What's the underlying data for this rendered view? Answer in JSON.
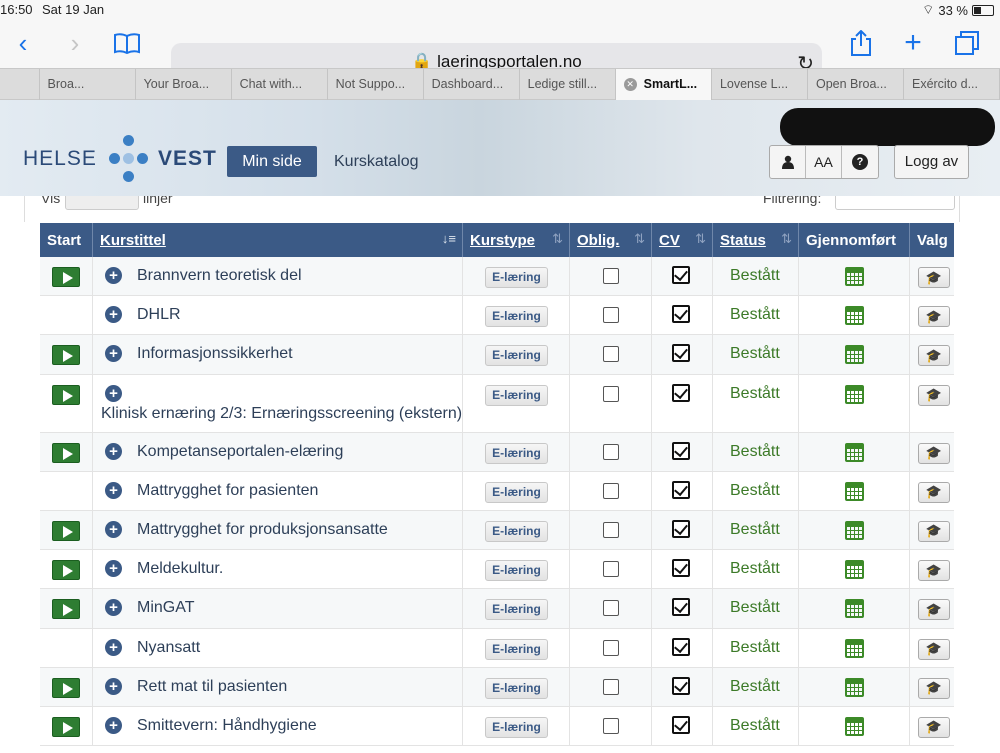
{
  "status_bar": {
    "time": "16:50",
    "date": "Sat 19 Jan",
    "battery": "33 %"
  },
  "browser": {
    "url": "laeringsportalen.no",
    "tabs": [
      "",
      "Broa...",
      "Your Broa...",
      "Chat with...",
      "Not Suppo...",
      "Dashboard...",
      "Ledige still...",
      "SmartL...",
      "Lovense L...",
      "Open Broa...",
      "Exército d..."
    ],
    "active_tab": 7
  },
  "header": {
    "logo_left": "HELSE",
    "logo_right": "VEST",
    "min_side": "Min side",
    "kurskatalog": "Kurskatalog",
    "logg_av": "Logg av",
    "font_btn": "AA"
  },
  "partial": {
    "vis": "Vis",
    "linjer": "linjer",
    "filtrering": "Filtrering:"
  },
  "table": {
    "columns": [
      "Start",
      "Kurstittel",
      "Kurstype",
      "Oblig.",
      "CV",
      "Status",
      "Gjennomført",
      "Valg"
    ],
    "rows": [
      {
        "start": true,
        "title": "Brannvern teoretisk del",
        "type": "E-læring",
        "oblig": false,
        "cv": true,
        "status": "Bestått",
        "wrap": false
      },
      {
        "start": false,
        "title": "DHLR",
        "type": "E-læring",
        "oblig": false,
        "cv": true,
        "status": "Bestått",
        "wrap": false
      },
      {
        "start": true,
        "title": "Informasjonssikkerhet",
        "type": "E-læring",
        "oblig": false,
        "cv": true,
        "status": "Bestått",
        "wrap": false
      },
      {
        "start": true,
        "title": "Klinisk ernæring 2/3: Ernæringsscreening (ekstern)",
        "type": "E-læring",
        "oblig": false,
        "cv": true,
        "status": "Bestått",
        "wrap": true
      },
      {
        "start": true,
        "title": "Kompetanseportalen-elæring",
        "type": "E-læring",
        "oblig": false,
        "cv": true,
        "status": "Bestått",
        "wrap": false
      },
      {
        "start": false,
        "title": "Mattrygghet for pasienten",
        "type": "E-læring",
        "oblig": false,
        "cv": true,
        "status": "Bestått",
        "wrap": false
      },
      {
        "start": true,
        "title": "Mattrygghet for produksjonsansatte",
        "type": "E-læring",
        "oblig": false,
        "cv": true,
        "status": "Bestått",
        "wrap": false
      },
      {
        "start": true,
        "title": "Meldekultur.",
        "type": "E-læring",
        "oblig": false,
        "cv": true,
        "status": "Bestått",
        "wrap": false
      },
      {
        "start": true,
        "title": "MinGAT",
        "type": "E-læring",
        "oblig": false,
        "cv": true,
        "status": "Bestått",
        "wrap": false
      },
      {
        "start": false,
        "title": "Nyansatt",
        "type": "E-læring",
        "oblig": false,
        "cv": true,
        "status": "Bestått",
        "wrap": false
      },
      {
        "start": true,
        "title": "Rett mat til pasienten",
        "type": "E-læring",
        "oblig": false,
        "cv": true,
        "status": "Bestått",
        "wrap": false
      },
      {
        "start": true,
        "title": "Smittevern: Håndhygiene",
        "type": "E-læring",
        "oblig": false,
        "cv": true,
        "status": "Bestått",
        "wrap": false
      }
    ]
  },
  "colors": {
    "brand": "#3b5a86",
    "status_ok": "#3c7a28",
    "start_button": "#2e7d32",
    "link": "#1a73e8"
  }
}
